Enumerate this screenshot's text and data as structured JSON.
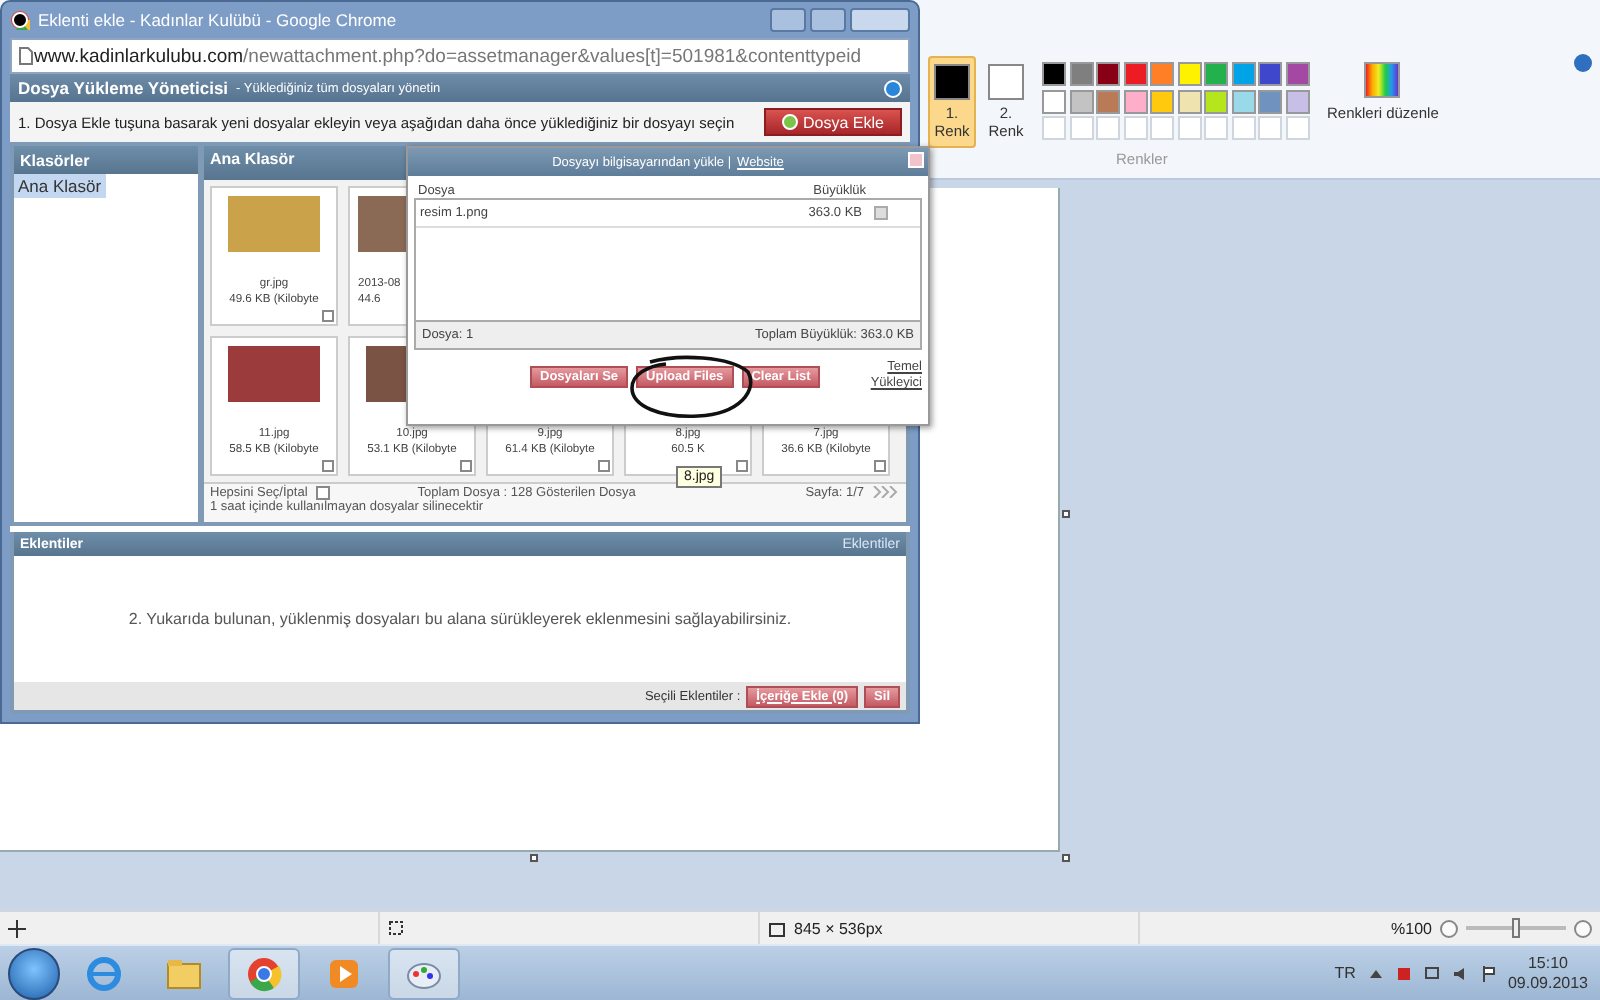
{
  "paint": {
    "ribbon": {
      "color1": {
        "label": "1. Renk",
        "selected": true
      },
      "color2": {
        "label": "2. Renk",
        "selected": false
      },
      "palette": [
        {
          "color": "#000000"
        },
        {
          "color": "#7f7f7f"
        },
        {
          "color": "#880015"
        },
        {
          "color": "#ed1c24"
        },
        {
          "color": "#ff7f27"
        },
        {
          "color": "#fff200"
        },
        {
          "color": "#22b14c"
        },
        {
          "color": "#00a2e8"
        },
        {
          "color": "#3f48cc"
        },
        {
          "color": "#a349a4"
        },
        {
          "color": "#ffffff"
        },
        {
          "color": "#c3c3c3"
        },
        {
          "color": "#b97a57"
        },
        {
          "color": "#ffaec9"
        },
        {
          "color": "#ffc90e"
        },
        {
          "color": "#efe4b0"
        },
        {
          "color": "#b5e61d"
        },
        {
          "color": "#99d9ea"
        },
        {
          "color": "#7092be"
        },
        {
          "color": "#c8bfe7"
        }
      ],
      "edit_colors": "Renkleri düzenle",
      "group_label": "Renkler"
    },
    "status_bar": {
      "image_size": "845 × 536px",
      "zoom": "%100",
      "zoom_slider": {
        "level": 0.5
      }
    }
  },
  "browser": {
    "title": "Eklenti ekle - Kadınlar Kulübü - Google Chrome",
    "url_host": "www.kadinlarkulubu.com",
    "url_path": "/newattachment.php?do=assetmanager&values[t]=501981&contenttypeid"
  },
  "page": {
    "header": {
      "title": "Dosya Yükleme Yöneticisi",
      "subtitle": "- Yüklediğiniz tüm dosyaları yönetin"
    },
    "instruction": "1. Dosya Ekle tuşuna basarak yeni dosyalar ekleyin veya aşağıdan daha önce yüklediğiniz bir dosyayı seçin",
    "add_button": "Dosya Ekle",
    "folders": {
      "title": "Klasörler",
      "items": [
        {
          "label": "Ana Klasör",
          "selected": true
        }
      ]
    },
    "files": {
      "title": "Ana Klasör",
      "rows": [
        [
          {
            "name": "gr.jpg",
            "size": "49.6 KB (Kilobyte",
            "checked": false
          },
          {
            "name": "2013-08",
            "size": "44.6"
          }
        ],
        [
          {
            "name": "11.jpg",
            "size": "58.5 KB (Kilobyte",
            "checked": false
          },
          {
            "name": "10.jpg",
            "size": "53.1 KB (Kilobyte",
            "checked": false
          },
          {
            "name": "9.jpg",
            "size": "61.4 KB (Kilobyte",
            "checked": false
          },
          {
            "name": "8.jpg",
            "size": "60.5 K",
            "checked": false
          },
          {
            "name": "7.jpg",
            "size": "36.6 KB (Kilobyte",
            "checked": false
          }
        ]
      ],
      "select_all": {
        "label": "Hepsini Seç/İptal",
        "checked": false
      },
      "total": "Toplam Dosya : 128 Gösterilen Dosya",
      "page": "Sayfa: 1/7",
      "notice": "1 saat içinde kullanılmayan dosyalar silinecektir"
    },
    "tooltip": "8.jpg",
    "upload_dialog": {
      "title": "Dosyayı bilgisayarından yükle |",
      "title_link": "Website",
      "columns": [
        "Dosya",
        "Büyüklük"
      ],
      "rows": [
        {
          "file": "resim 1.png",
          "size": "363.0 KB"
        }
      ],
      "count": "Dosya: 1",
      "total": "Toplam Büyüklük: 363.0 KB",
      "buttons": [
        "Dosyaları Se",
        "Upload Files",
        "Clear List"
      ],
      "basic_link": "Temel Yükleyici"
    },
    "attachments": {
      "title": "Eklentiler",
      "link": "Eklentiler",
      "hint": "2. Yukarıda bulunan, yüklenmiş dosyaları bu alana sürükleyerek eklenmesini sağlayabilirsiniz.",
      "selected_label": "Seçili Eklentiler :",
      "buttons": [
        "İçeriğe Ekle (0)",
        "Sil"
      ]
    }
  },
  "taskbar": {
    "apps": [
      {
        "kind": "ie",
        "selected": false
      },
      {
        "kind": "folder",
        "selected": false
      },
      {
        "kind": "chrome",
        "selected": true
      },
      {
        "kind": "media",
        "selected": false
      },
      {
        "kind": "paint",
        "selected": true
      }
    ],
    "language": "TR",
    "time": "15:10",
    "date": "09.09.2013"
  }
}
